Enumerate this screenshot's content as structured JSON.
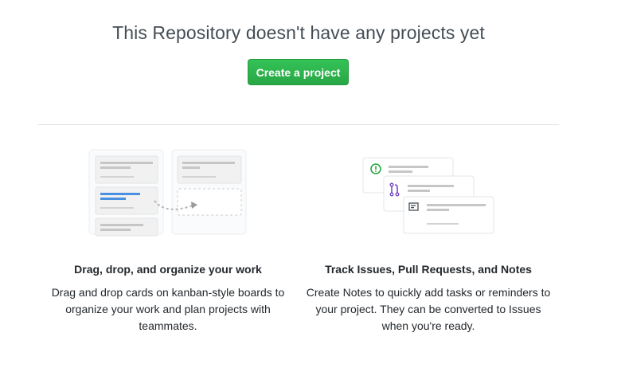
{
  "empty_state": {
    "title": "This Repository doesn't have any projects yet",
    "create_button": "Create a project"
  },
  "features": [
    {
      "heading": "Drag, drop, and organize your work",
      "description": "Drag and drop cards on kanban-style boards to organize your work and plan projects with teammates."
    },
    {
      "heading": "Track Issues, Pull Requests, and Notes",
      "description": "Create Notes to quickly add tasks or reminders to your project. They can be converted to Issues when you're ready."
    }
  ],
  "illustration_icons": [
    "issue-icon",
    "pull-request-icon",
    "note-icon"
  ],
  "colors": {
    "accent_green": "#28a745",
    "card_blue": "#4a90e2",
    "issue_green": "#28a745",
    "pr_purple": "#6f42c1"
  }
}
